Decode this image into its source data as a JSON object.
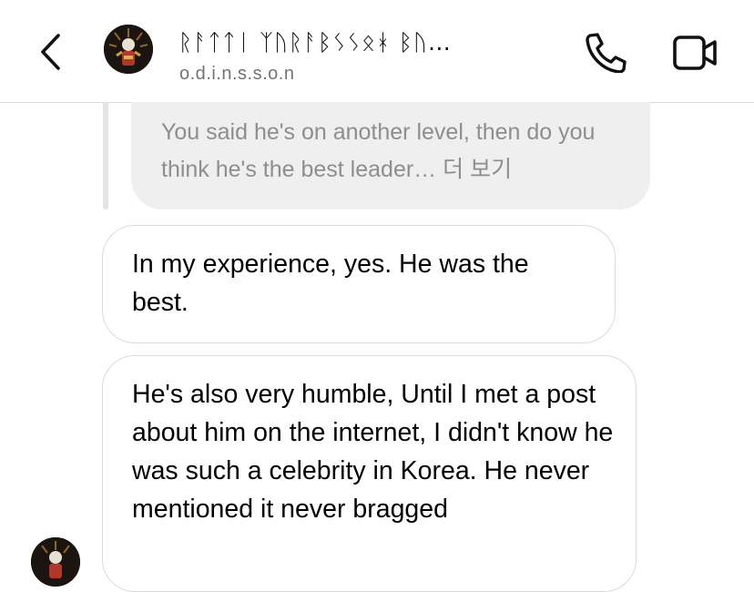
{
  "header": {
    "title": "ᚱᚨᛏᛏᛁ ᛉᚢᚱᚨᛒᛊᛊᛟᚼ ᛒᚢ…",
    "username": "o.d.i.n.s.s.o.n",
    "back_icon": "chevron-left-icon",
    "call_icon": "phone-icon",
    "video_icon": "video-camera-icon"
  },
  "messages": {
    "quoted_reply": "You said he's on another level, then do you think he's the best leader… 더 보기",
    "items": [
      {
        "text": "In my experience, yes. He was the best."
      },
      {
        "text": "He's also very humble, Until I met a post about him on the internet, I didn't know he was such a celebrity in Korea. He never mentioned it never bragged"
      }
    ]
  },
  "colors": {
    "secondary_text": "#737373",
    "quoted_bg": "#efefef",
    "bubble_border": "#dbdbdb"
  }
}
